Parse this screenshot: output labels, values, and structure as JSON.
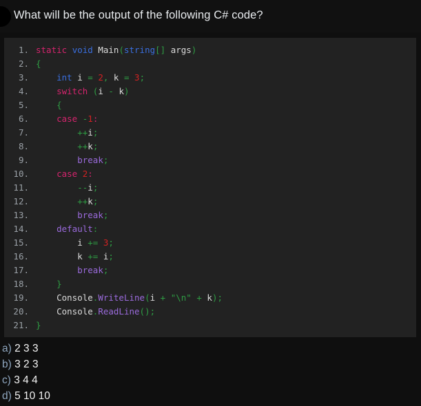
{
  "question": {
    "avatar_icon": "avatar-circle-icon",
    "title": "What will be the output of the following C# code?"
  },
  "code": {
    "language": "C#",
    "lines": [
      {
        "number": "1.",
        "indent": 0,
        "tokens": [
          {
            "t": "static",
            "c": "t-kw"
          },
          {
            "t": " ",
            "c": "t-plain"
          },
          {
            "t": "void",
            "c": "t-type"
          },
          {
            "t": " ",
            "c": "t-plain"
          },
          {
            "t": "Main",
            "c": "t-plain"
          },
          {
            "t": "(",
            "c": "t-punc"
          },
          {
            "t": "string",
            "c": "t-type"
          },
          {
            "t": "[]",
            "c": "t-punc"
          },
          {
            "t": " args",
            "c": "t-plain"
          },
          {
            "t": ")",
            "c": "t-punc"
          }
        ]
      },
      {
        "number": "2.",
        "indent": 0,
        "tokens": [
          {
            "t": "{",
            "c": "t-punc"
          }
        ]
      },
      {
        "number": "3.",
        "indent": 1,
        "tokens": [
          {
            "t": "int",
            "c": "t-type"
          },
          {
            "t": " i ",
            "c": "t-plain"
          },
          {
            "t": "=",
            "c": "t-punc"
          },
          {
            "t": " ",
            "c": "t-plain"
          },
          {
            "t": "2",
            "c": "t-num"
          },
          {
            "t": ",",
            "c": "t-punc"
          },
          {
            "t": " k ",
            "c": "t-plain"
          },
          {
            "t": "=",
            "c": "t-punc"
          },
          {
            "t": " ",
            "c": "t-plain"
          },
          {
            "t": "3",
            "c": "t-num"
          },
          {
            "t": ";",
            "c": "t-punc"
          }
        ]
      },
      {
        "number": "4.",
        "indent": 1,
        "tokens": [
          {
            "t": "switch",
            "c": "t-kw"
          },
          {
            "t": " ",
            "c": "t-plain"
          },
          {
            "t": "(",
            "c": "t-punc"
          },
          {
            "t": "i ",
            "c": "t-plain"
          },
          {
            "t": "-",
            "c": "t-punc"
          },
          {
            "t": " k",
            "c": "t-plain"
          },
          {
            "t": ")",
            "c": "t-punc"
          }
        ]
      },
      {
        "number": "5.",
        "indent": 1,
        "tokens": [
          {
            "t": "{",
            "c": "t-punc"
          }
        ]
      },
      {
        "number": "6.",
        "indent": 1,
        "tokens": [
          {
            "t": "case",
            "c": "t-kw"
          },
          {
            "t": " ",
            "c": "t-plain"
          },
          {
            "t": "-",
            "c": "t-punc"
          },
          {
            "t": "1",
            "c": "t-num"
          },
          {
            "t": ":",
            "c": "t-kw"
          }
        ]
      },
      {
        "number": "7.",
        "indent": 2,
        "tokens": [
          {
            "t": "++",
            "c": "t-punc"
          },
          {
            "t": "i",
            "c": "t-plain"
          },
          {
            "t": ";",
            "c": "t-punc"
          }
        ]
      },
      {
        "number": "8.",
        "indent": 2,
        "tokens": [
          {
            "t": "++",
            "c": "t-punc"
          },
          {
            "t": "k",
            "c": "t-plain"
          },
          {
            "t": ";",
            "c": "t-punc"
          }
        ]
      },
      {
        "number": "9.",
        "indent": 2,
        "tokens": [
          {
            "t": "break",
            "c": "t-ctrl"
          },
          {
            "t": ";",
            "c": "t-punc"
          }
        ]
      },
      {
        "number": "10.",
        "indent": 1,
        "tokens": [
          {
            "t": "case",
            "c": "t-kw"
          },
          {
            "t": " ",
            "c": "t-plain"
          },
          {
            "t": "2",
            "c": "t-num"
          },
          {
            "t": ":",
            "c": "t-kw"
          }
        ]
      },
      {
        "number": "11.",
        "indent": 2,
        "tokens": [
          {
            "t": "--",
            "c": "t-punc"
          },
          {
            "t": "i",
            "c": "t-plain"
          },
          {
            "t": ";",
            "c": "t-punc"
          }
        ]
      },
      {
        "number": "12.",
        "indent": 2,
        "tokens": [
          {
            "t": "++",
            "c": "t-punc"
          },
          {
            "t": "k",
            "c": "t-plain"
          },
          {
            "t": ";",
            "c": "t-punc"
          }
        ]
      },
      {
        "number": "13.",
        "indent": 2,
        "tokens": [
          {
            "t": "break",
            "c": "t-ctrl"
          },
          {
            "t": ";",
            "c": "t-punc"
          }
        ]
      },
      {
        "number": "14.",
        "indent": 1,
        "tokens": [
          {
            "t": "default",
            "c": "t-ctrl"
          },
          {
            "t": ":",
            "c": "t-punc"
          }
        ]
      },
      {
        "number": "15.",
        "indent": 2,
        "tokens": [
          {
            "t": "i ",
            "c": "t-plain"
          },
          {
            "t": "+=",
            "c": "t-punc"
          },
          {
            "t": " ",
            "c": "t-plain"
          },
          {
            "t": "3",
            "c": "t-num"
          },
          {
            "t": ";",
            "c": "t-punc"
          }
        ]
      },
      {
        "number": "16.",
        "indent": 2,
        "tokens": [
          {
            "t": "k ",
            "c": "t-plain"
          },
          {
            "t": "+=",
            "c": "t-punc"
          },
          {
            "t": " i",
            "c": "t-plain"
          },
          {
            "t": ";",
            "c": "t-punc"
          }
        ]
      },
      {
        "number": "17.",
        "indent": 2,
        "tokens": [
          {
            "t": "break",
            "c": "t-ctrl"
          },
          {
            "t": ";",
            "c": "t-punc"
          }
        ]
      },
      {
        "number": "18.",
        "indent": 1,
        "tokens": [
          {
            "t": "}",
            "c": "t-punc"
          }
        ]
      },
      {
        "number": "19.",
        "indent": 1,
        "tokens": [
          {
            "t": "Console",
            "c": "t-plain"
          },
          {
            "t": ".",
            "c": "t-punc"
          },
          {
            "t": "WriteLine",
            "c": "t-ctrl"
          },
          {
            "t": "(",
            "c": "t-punc"
          },
          {
            "t": "i ",
            "c": "t-plain"
          },
          {
            "t": "+",
            "c": "t-punc"
          },
          {
            "t": " ",
            "c": "t-plain"
          },
          {
            "t": "\"\\n\"",
            "c": "t-str"
          },
          {
            "t": " ",
            "c": "t-plain"
          },
          {
            "t": "+",
            "c": "t-punc"
          },
          {
            "t": " k",
            "c": "t-plain"
          },
          {
            "t": ")",
            "c": "t-punc"
          },
          {
            "t": ";",
            "c": "t-punc"
          }
        ]
      },
      {
        "number": "20.",
        "indent": 1,
        "tokens": [
          {
            "t": "Console",
            "c": "t-plain"
          },
          {
            "t": ".",
            "c": "t-punc"
          },
          {
            "t": "ReadLine",
            "c": "t-ctrl"
          },
          {
            "t": "()",
            "c": "t-punc"
          },
          {
            "t": ";",
            "c": "t-punc"
          }
        ]
      },
      {
        "number": "21.",
        "indent": 0,
        "tokens": [
          {
            "t": "}",
            "c": "t-punc"
          }
        ]
      }
    ]
  },
  "options": [
    {
      "letter": "a)",
      "value": "2 3 3"
    },
    {
      "letter": "b)",
      "value": "3 2 3"
    },
    {
      "letter": "c)",
      "value": "3 4 4"
    },
    {
      "letter": "d)",
      "value": "5 10 10"
    }
  ],
  "colors": {
    "page_background": "#0f0f0f",
    "header_background": "#111111",
    "code_background": "#222222",
    "line_number": "#9aa0a6",
    "keyword": "#d6246e",
    "type": "#3a6fe0",
    "punctuation": "#2f9e44",
    "number_literal": "#d32222",
    "control": "#9b6bdd",
    "string_literal": "#2f9e44",
    "option_letter": "#8fa6bf",
    "title_text": "#e9ecef"
  }
}
